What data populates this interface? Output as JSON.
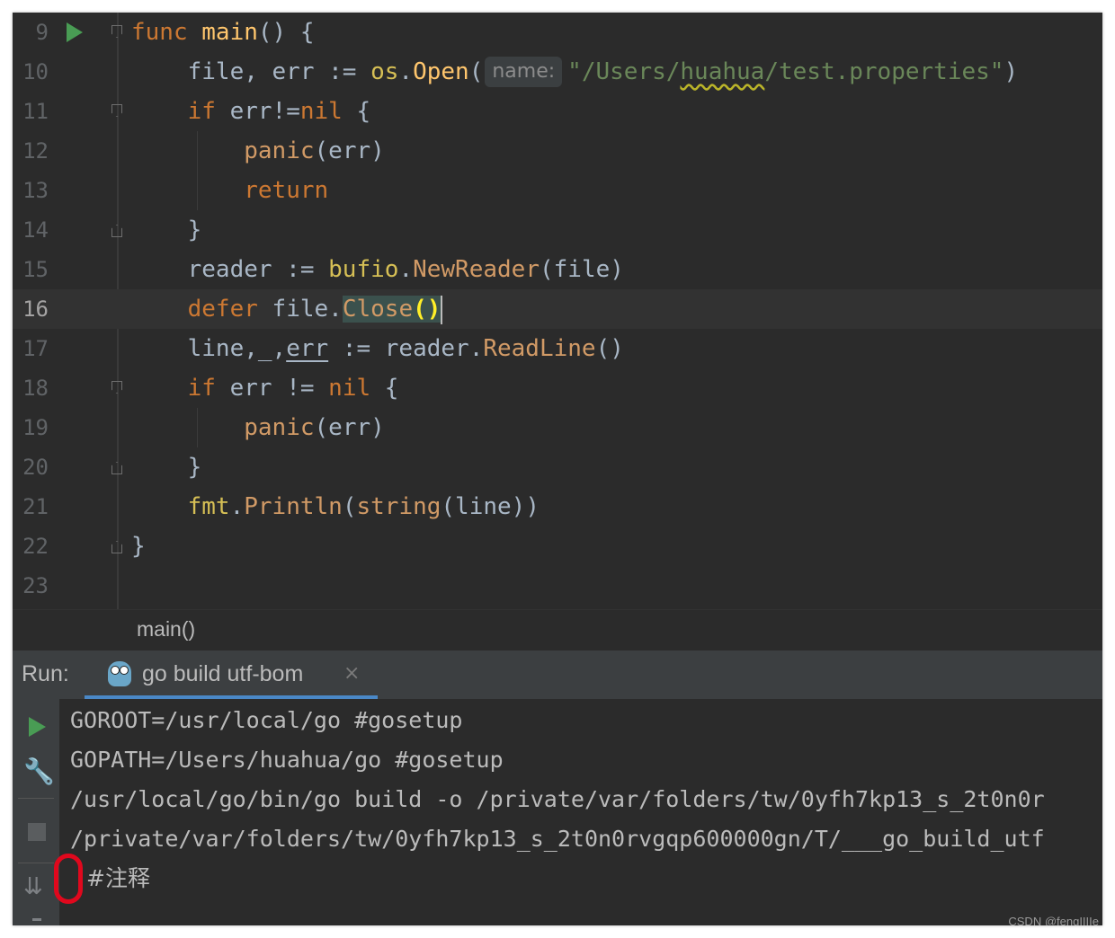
{
  "editor": {
    "lines": [
      {
        "num": "9",
        "tokens": [
          {
            "t": "func ",
            "c": "kw"
          },
          {
            "t": "main",
            "c": "fn"
          },
          {
            "t": "() {",
            "c": "plain"
          }
        ]
      },
      {
        "num": "10",
        "tokens": [
          {
            "t": "    file, err := ",
            "c": "plain"
          },
          {
            "t": "os",
            "c": "pkg"
          },
          {
            "t": ".",
            "c": "plain"
          },
          {
            "t": "Open",
            "c": "fn"
          },
          {
            "t": "(",
            "c": "plain"
          },
          {
            "t": "name:",
            "c": "hint"
          },
          {
            "t": "\"/Users/",
            "c": "str"
          },
          {
            "t": "huahua",
            "c": "str-squiggle"
          },
          {
            "t": "/test.properties\"",
            "c": "str"
          },
          {
            "t": ")",
            "c": "plain"
          }
        ]
      },
      {
        "num": "11",
        "tokens": [
          {
            "t": "    ",
            "c": "plain"
          },
          {
            "t": "if",
            "c": "kw"
          },
          {
            "t": " err!=",
            "c": "plain"
          },
          {
            "t": "nil",
            "c": "kw"
          },
          {
            "t": " {",
            "c": "plain"
          }
        ]
      },
      {
        "num": "12",
        "tokens": [
          {
            "t": "        ",
            "c": "plain"
          },
          {
            "t": "panic",
            "c": "builtin"
          },
          {
            "t": "(err)",
            "c": "plain"
          }
        ]
      },
      {
        "num": "13",
        "tokens": [
          {
            "t": "        ",
            "c": "plain"
          },
          {
            "t": "return",
            "c": "kw"
          }
        ]
      },
      {
        "num": "14",
        "tokens": [
          {
            "t": "    }",
            "c": "plain"
          }
        ]
      },
      {
        "num": "15",
        "tokens": [
          {
            "t": "    reader := ",
            "c": "plain"
          },
          {
            "t": "bufio",
            "c": "pkg"
          },
          {
            "t": ".",
            "c": "plain"
          },
          {
            "t": "NewReader",
            "c": "call"
          },
          {
            "t": "(file)",
            "c": "plain"
          }
        ]
      },
      {
        "num": "16",
        "tokens": [
          {
            "t": "    ",
            "c": "plain"
          },
          {
            "t": "defer",
            "c": "kw"
          },
          {
            "t": " file.",
            "c": "plain"
          },
          {
            "t": "Close",
            "c": "hl-close"
          },
          {
            "t": "()",
            "c": "brace-match"
          },
          {
            "t": "",
            "c": "caret"
          }
        ]
      },
      {
        "num": "17",
        "tokens": [
          {
            "t": "    line,_,",
            "c": "plain"
          },
          {
            "t": "err",
            "c": "underline"
          },
          {
            "t": " := reader.",
            "c": "plain"
          },
          {
            "t": "ReadLine",
            "c": "call"
          },
          {
            "t": "()",
            "c": "plain"
          }
        ]
      },
      {
        "num": "18",
        "tokens": [
          {
            "t": "    ",
            "c": "plain"
          },
          {
            "t": "if",
            "c": "kw"
          },
          {
            "t": " err != ",
            "c": "plain"
          },
          {
            "t": "nil",
            "c": "kw"
          },
          {
            "t": " {",
            "c": "plain"
          }
        ]
      },
      {
        "num": "19",
        "tokens": [
          {
            "t": "        ",
            "c": "plain"
          },
          {
            "t": "panic",
            "c": "builtin"
          },
          {
            "t": "(err)",
            "c": "plain"
          }
        ]
      },
      {
        "num": "20",
        "tokens": [
          {
            "t": "    }",
            "c": "plain"
          }
        ]
      },
      {
        "num": "21",
        "tokens": [
          {
            "t": "    ",
            "c": "plain"
          },
          {
            "t": "fmt",
            "c": "pkg"
          },
          {
            "t": ".",
            "c": "plain"
          },
          {
            "t": "Println",
            "c": "call"
          },
          {
            "t": "(",
            "c": "plain"
          },
          {
            "t": "string",
            "c": "builtin"
          },
          {
            "t": "(line))",
            "c": "plain"
          }
        ]
      },
      {
        "num": "22",
        "tokens": [
          {
            "t": "}",
            "c": "plain"
          }
        ]
      },
      {
        "num": "23",
        "tokens": []
      }
    ]
  },
  "breadcrumb": {
    "text": "main()"
  },
  "run_panel": {
    "label": "Run:",
    "tab_label": "go build utf-bom",
    "tab_close": "×",
    "console_lines": [
      "GOROOT=/usr/local/go #gosetup",
      "GOPATH=/Users/huahua/go #gosetup",
      "/usr/local/go/bin/go build -o /private/var/folders/tw/0yfh7kp13_s_2t0n0r",
      "/private/var/folders/tw/0yfh7kp13_s_2t0n0rvgqp600000gn/T/___go_build_utf",
      "﻿#注释"
    ]
  },
  "colors": {
    "accent": "#4a88c7",
    "run_green": "#499c54",
    "annotation_red": "#e0081d"
  },
  "icons": {
    "gutter_run": "run-triangle-icon",
    "toolbar": [
      "run-icon",
      "wrench-icon",
      "stop-icon",
      "scroll-to-end-icon"
    ]
  },
  "watermark": "CSDN @fengIIIIe"
}
